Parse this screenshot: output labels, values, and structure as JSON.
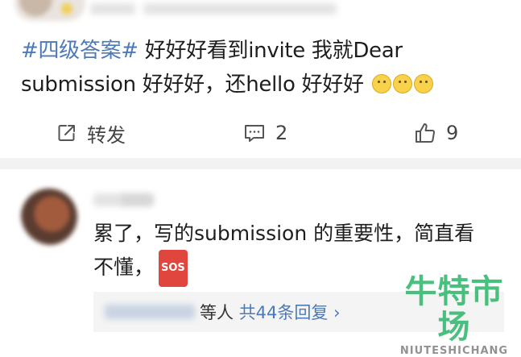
{
  "post": {
    "topic": "#四级答案#",
    "text_line1_rest": "好好好看到invite 我就Dear",
    "text_line2": "submission 好好好，还hello 好好好"
  },
  "actions": {
    "repost_label": "转发",
    "comment_count": "2",
    "like_count": "9"
  },
  "comment": {
    "text_line1": "累了，写的submission 的重要性，简直看",
    "text_line2": "不懂，",
    "badge": "SOS"
  },
  "replies": {
    "suffix": "等人",
    "link": "共44条回复",
    "chevron": "›"
  },
  "watermark": {
    "main": "牛特市场",
    "sub": "NIUTESHICHANG"
  },
  "colors": {
    "topic": "#4c7ab8",
    "watermark": "#32b86e",
    "sos": "#e0463e"
  }
}
